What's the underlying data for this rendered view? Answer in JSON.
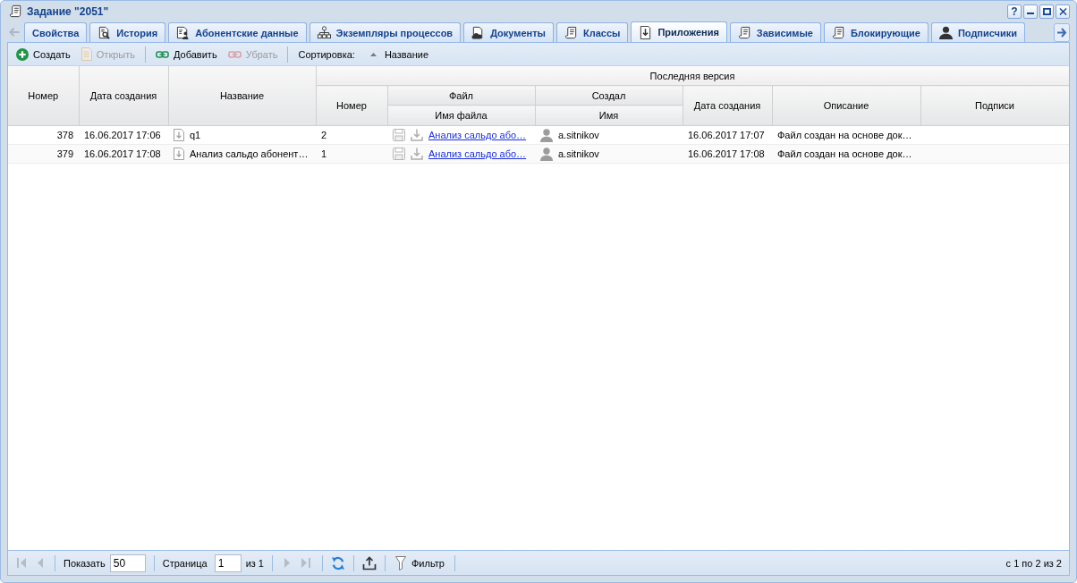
{
  "window": {
    "title": "Задание \"2051\"",
    "controls": [
      {
        "kind": "help",
        "label": "?"
      },
      {
        "kind": "minimize"
      },
      {
        "kind": "maximize"
      },
      {
        "kind": "close"
      }
    ]
  },
  "tab_scroller": {
    "back_disabled": true,
    "forward_disabled": false
  },
  "tabs": [
    {
      "label": "Свойства",
      "kind": "plain",
      "selected": false
    },
    {
      "label": "История",
      "kind": "history",
      "selected": false
    },
    {
      "label": "Абонентские данные",
      "kind": "subscriber",
      "selected": false
    },
    {
      "label": "Экземпляры процессов",
      "kind": "process",
      "selected": false
    },
    {
      "label": "Документы",
      "kind": "documents",
      "selected": false
    },
    {
      "label": "Классы",
      "kind": "record",
      "selected": false
    },
    {
      "label": "Приложения",
      "kind": "attachment",
      "selected": true
    },
    {
      "label": "Зависимые",
      "kind": "record",
      "selected": false
    },
    {
      "label": "Блокирующие",
      "kind": "record",
      "selected": false
    },
    {
      "label": "Подписчики",
      "kind": "user",
      "selected": false
    }
  ],
  "toolbar": {
    "groups": [
      {
        "buttons": [
          {
            "kind": "create",
            "label": "Создать",
            "disabled": false
          },
          {
            "kind": "open",
            "label": "Открыть",
            "disabled": true
          }
        ]
      },
      {
        "buttons": [
          {
            "kind": "link",
            "label": "Добавить",
            "disabled": false
          },
          {
            "kind": "unlink",
            "label": "Убрать",
            "disabled": true
          }
        ]
      }
    ],
    "sort": {
      "label": "Сортировка:",
      "fields": [
        {
          "label": "Название",
          "ascending": true
        }
      ]
    }
  },
  "table": {
    "columns": [
      {
        "label": "Номер"
      },
      {
        "label": "Дата создания"
      },
      {
        "label": "Название"
      }
    ],
    "group": {
      "label": "Последняя версия",
      "columns": [
        {
          "label": "Номер"
        },
        {
          "label": "Файл",
          "sub": "Имя файла"
        },
        {
          "label": "Создал",
          "sub": "Имя"
        },
        {
          "label": "Дата создания"
        },
        {
          "label": "Описание"
        },
        {
          "label": "Подписи"
        }
      ]
    },
    "rows": [
      {
        "number": "378",
        "created": "16.06.2017 17:06",
        "name": "q1",
        "version": "2",
        "file": "Анализ сальдо або…",
        "author": "a.sitnikov",
        "version_date": "16.06.2017 17:07",
        "description": "Файл создан на основе док…",
        "selected": false
      },
      {
        "number": "379",
        "created": "16.06.2017 17:08",
        "name": "Анализ сальдо абонент…",
        "version": "1",
        "file": "Анализ сальдо або…",
        "author": "a.sitnikov",
        "version_date": "16.06.2017 17:08",
        "description": "Файл создан на основе док…",
        "selected": false
      }
    ]
  },
  "pager": {
    "back": [
      {
        "kind": "first",
        "disabled": true
      },
      {
        "kind": "prev",
        "disabled": true
      }
    ],
    "show_label": "Показать",
    "page_size": "50",
    "page_label": "Страница",
    "page": "1",
    "page_count": "из 1",
    "forward": [
      {
        "kind": "next",
        "disabled": true
      },
      {
        "kind": "last",
        "disabled": true
      }
    ],
    "filter_label": "Фильтр",
    "summary": "с 1 по 2 из 2"
  }
}
